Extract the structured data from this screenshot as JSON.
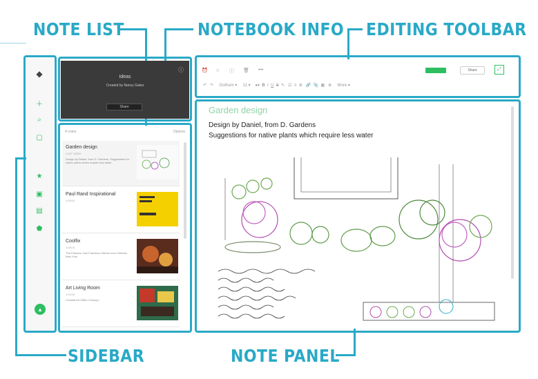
{
  "callouts": {
    "note_list": "NOTE LIST",
    "notebook_info": "NOTEBOOK INFO",
    "editing_toolbar": "EDITING TOOLBAR",
    "sidebar": "SIDEBAR",
    "note_panel": "NOTE PANEL"
  },
  "notebook": {
    "title": "Ideas",
    "subtitle": "Created by Nancy Gates",
    "share_label": "Share"
  },
  "note_list": {
    "count_label": "4 notes",
    "options_label": "Options",
    "items": [
      {
        "title": "Garden design",
        "date": "LAST WEEK",
        "snippet": "Design by Daniel, from D. Gardens. Suggestions for native plants which require less water"
      },
      {
        "title": "Paul Rand Inspirational",
        "date": "1/28/16",
        "snippet": ""
      },
      {
        "title": "Coolfix",
        "date": "1/28/16",
        "snippet": "The Palomar, San Francisco Dished over Chinese, New York"
      },
      {
        "title": "Art Living Room",
        "date": "1/15/16",
        "snippet": "Cocktail Art Office Concept"
      }
    ]
  },
  "toolbar": {
    "share_label": "Share",
    "font_label": "Gotham",
    "size_label": "11",
    "more_label": "More"
  },
  "note": {
    "title": "Garden design",
    "line1": "Design by Daniel, from D. Gardens",
    "line2": "Suggestions for native plants which require less water"
  },
  "colors": {
    "callout": "#29a9c7",
    "accent_green": "#2dbe60",
    "notebook_bg": "#3a3a3a"
  }
}
